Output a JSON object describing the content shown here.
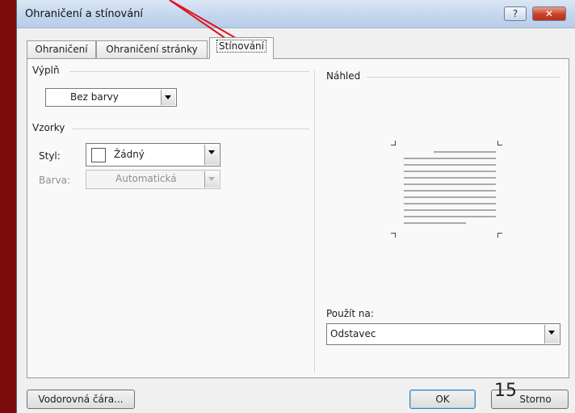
{
  "dialog": {
    "title": "Ohraničení a stínování",
    "help_glyph": "?",
    "close_glyph": "✕"
  },
  "tabs": [
    {
      "label": "Ohraničení"
    },
    {
      "label": "Ohraničení stránky"
    },
    {
      "label": "Stínování",
      "active": true
    }
  ],
  "fill": {
    "group_label": "Výplň",
    "color_value": "Bez barvy"
  },
  "patterns": {
    "group_label": "Vzorky",
    "style_label": "Styl:",
    "style_value": "Žádný",
    "color_label": "Barva:",
    "color_value": "Automatická"
  },
  "preview": {
    "group_label": "Náhled"
  },
  "apply_to": {
    "label": "Použít na:",
    "value": "Odstavec"
  },
  "footer": {
    "horizontal_line_button": "Vodorovná čára...",
    "ok_button": "OK",
    "cancel_button": "Storno"
  },
  "overlay": {
    "page_number": "15",
    "arrow_color": "#e0141c"
  },
  "colors": {
    "background": "#7a0c0c",
    "titlebar": "#c4d6ee",
    "close_button": "#c8412a"
  }
}
